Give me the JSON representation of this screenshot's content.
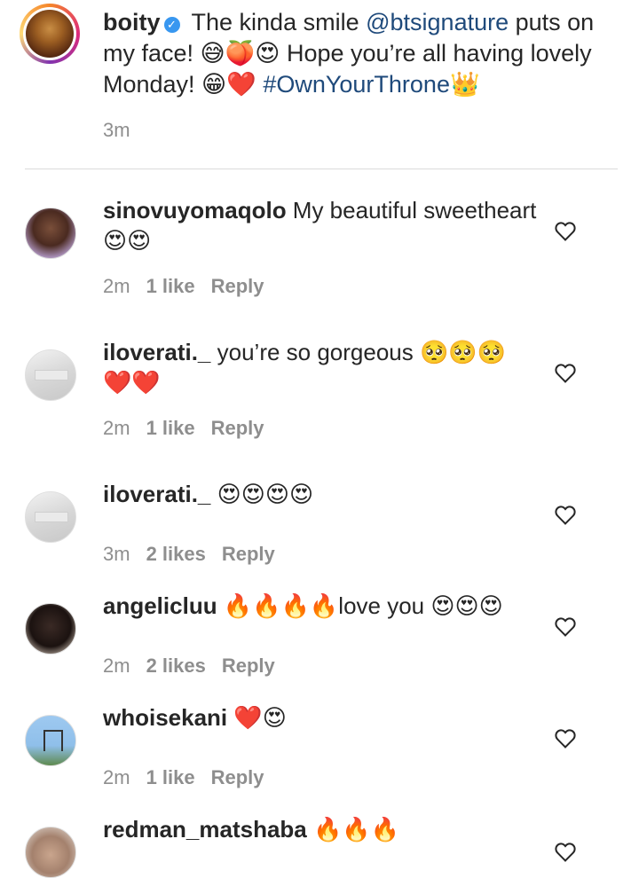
{
  "caption": {
    "username": "boity",
    "text_before_mention": " The kinda smile ",
    "mention": "@btsignature",
    "text_after_mention": " puts on my face! 😅🍑😍 Hope you’re all having lovely Monday! 😁❤️ ",
    "hashtag": "#OwnYourThrone",
    "trailing_emoji": "👑",
    "time": "3m",
    "verified_icon": "check-icon"
  },
  "comments": [
    {
      "username": "sinovuyomaqolo",
      "text": " My beautiful sweetheart 😍😍",
      "time": "2m",
      "likes": "1 like",
      "reply": "Reply"
    },
    {
      "username": "iloverati._",
      "text": " you’re so gorgeous 🥺🥺🥺 ❤️❤️",
      "time": "2m",
      "likes": "1 like",
      "reply": "Reply"
    },
    {
      "username": "iloverati._",
      "text": " 😍😍😍😍",
      "time": "3m",
      "likes": "2 likes",
      "reply": "Reply"
    },
    {
      "username": "angelicluu",
      "text": " 🔥🔥🔥🔥love you 😍😍😍",
      "time": "2m",
      "likes": "2 likes",
      "reply": "Reply"
    },
    {
      "username": "whoisekani",
      "text": " ❤️😍",
      "time": "2m",
      "likes": "1 like",
      "reply": "Reply"
    },
    {
      "username": "redman_matshaba",
      "text": " 🔥🔥🔥",
      "time": "",
      "likes": "",
      "reply": ""
    }
  ],
  "icons": {
    "like": "heart-outline-icon"
  },
  "colors": {
    "link": "#1f4a7b",
    "verified": "#3897f0",
    "meta": "#8e8e8e",
    "text": "#262626"
  }
}
